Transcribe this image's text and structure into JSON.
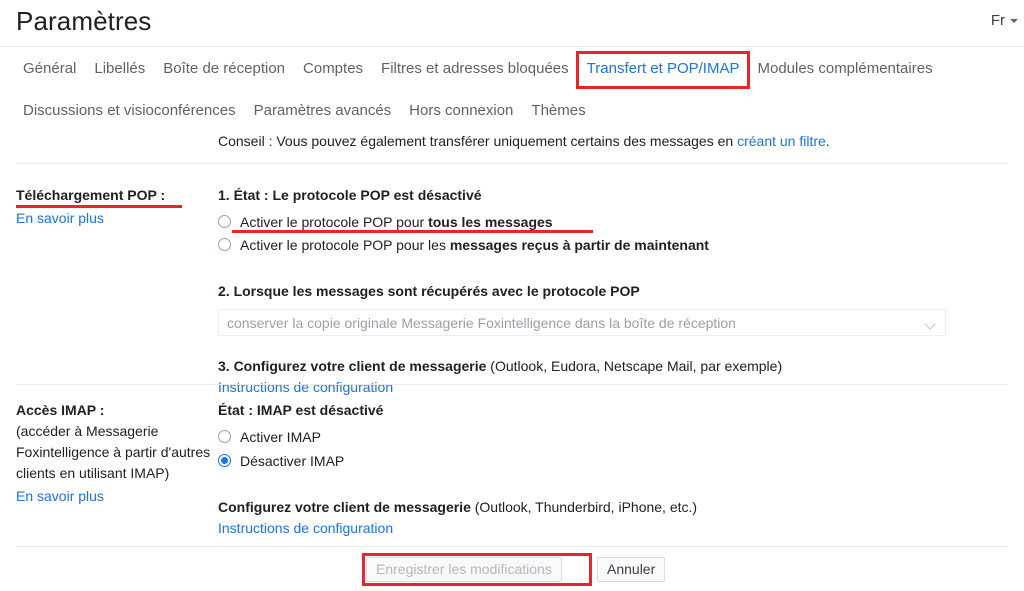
{
  "header": {
    "title": "Paramètres",
    "language_label": "Fr",
    "language_icon": "chevron-down-icon"
  },
  "tabs_row1": [
    {
      "label": "Général",
      "active": false,
      "highlighted": false
    },
    {
      "label": "Libellés",
      "active": false,
      "highlighted": false
    },
    {
      "label": "Boîte de réception",
      "active": false,
      "highlighted": false
    },
    {
      "label": "Comptes",
      "active": false,
      "highlighted": false
    },
    {
      "label": "Filtres et adresses bloquées",
      "active": false,
      "highlighted": false
    },
    {
      "label": "Transfert et POP/IMAP",
      "active": true,
      "highlighted": true
    },
    {
      "label": "Modules complémentaires",
      "active": false,
      "highlighted": false
    }
  ],
  "tabs_row2": [
    {
      "label": "Discussions et visioconférences",
      "active": false,
      "highlighted": false
    },
    {
      "label": "Paramètres avancés",
      "active": false,
      "highlighted": false
    },
    {
      "label": "Hors connexion",
      "active": false,
      "highlighted": false
    },
    {
      "label": "Thèmes",
      "active": false,
      "highlighted": false
    }
  ],
  "tip": {
    "prefix": "Conseil : Vous pouvez également transférer uniquement certains des messages en ",
    "link": "créant un filtre",
    "suffix": "."
  },
  "pop_section": {
    "label_title": "Téléchargement POP :",
    "learn_more": "En savoir plus",
    "step1_prefix": "1. État :",
    "step1_status": "Le protocole POP est désactivé",
    "option1": {
      "prefix": "Activer le protocole POP pour ",
      "bold": "tous les messages",
      "selected": false
    },
    "option2": {
      "prefix": "Activer le protocole POP pour les ",
      "bold": "messages reçus à partir de maintenant",
      "selected": false
    },
    "step2_title": "2. Lorsque les messages sont récupérés avec le protocole POP",
    "step2_select_value": "conserver la copie originale Messagerie Foxintelligence dans la boîte de réception",
    "step2_select_disabled": true,
    "step3_bold": "3. Configurez votre client de messagerie",
    "step3_normal": " (Outlook, Eudora, Netscape Mail, par exemple)",
    "step3_link": "Instructions de configuration"
  },
  "imap_section": {
    "label_title": "Accès IMAP :",
    "label_note_line1": "(accéder à Messagerie",
    "label_note_line2": "Foxintelligence à partir d'autres",
    "label_note_line3": "clients en utilisant IMAP)",
    "learn_more": "En savoir plus",
    "status": "État : IMAP est désactivé",
    "option_enable": {
      "label": "Activer IMAP",
      "selected": false
    },
    "option_disable": {
      "label": "Désactiver IMAP",
      "selected": true
    },
    "configure_bold": "Configurez votre client de messagerie",
    "configure_normal": " (Outlook, Thunderbird, iPhone, etc.)",
    "configure_link": "Instructions de configuration"
  },
  "footer": {
    "save_label": "Enregistrer les modifications",
    "save_disabled": true,
    "cancel_label": "Annuler"
  },
  "colors": {
    "accent_link": "#1a73e8",
    "annotation_red": "#e8252a",
    "text_primary": "#202124",
    "text_secondary": "#5f6368"
  }
}
